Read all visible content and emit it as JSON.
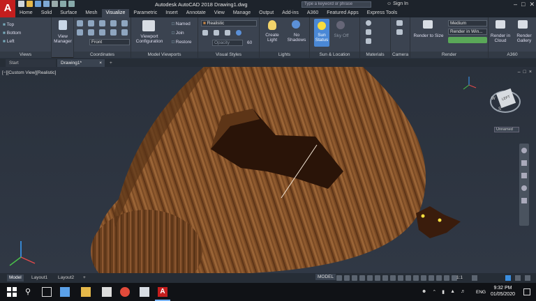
{
  "titlebar": {
    "app_logo": "A",
    "title": "Autodesk AutoCAD 2018    Drawing1.dwg",
    "search_placeholder": "Type a keyword or phrase",
    "signin": "Sign In"
  },
  "tabs": [
    "Home",
    "Solid",
    "Surface",
    "Mesh",
    "Visualize",
    "Parametric",
    "Insert",
    "Annotate",
    "View",
    "Manage",
    "Output",
    "Add-ins",
    "A360",
    "Featured Apps",
    "Express Tools"
  ],
  "active_tab": "Visualize",
  "ribbon": {
    "views": {
      "title": "Views",
      "items": [
        "Top",
        "Bottom",
        "Left"
      ]
    },
    "view_manager": "View Manager",
    "coordinates": {
      "title": "Coordinates",
      "ucs_value": "Front"
    },
    "model_viewports": {
      "title": "Model Viewports",
      "viewport_config": "Viewport Configuration",
      "named": "Named",
      "join": "Join",
      "restore": "Restore"
    },
    "visual_styles": {
      "title": "Visual Styles",
      "style_value": "Realistic",
      "opacity_value": "60"
    },
    "lights": {
      "title": "Lights",
      "create_light": "Create Light",
      "no_shadows": "No Shadows"
    },
    "sun_location": {
      "title": "Sun & Location",
      "sun_status": "Sun Status",
      "sky_off": "Sky Off"
    },
    "materials": {
      "title": "Materials"
    },
    "camera": {
      "title": "Camera"
    },
    "render": {
      "title": "Render",
      "render_to_size": "Render to Size",
      "quality": "Medium",
      "render_in": "Render in Win...",
      "render_cloud": "Render in Cloud",
      "render_gallery": "Render Gallery"
    },
    "a360": {
      "title": "A360"
    }
  },
  "file_tabs": [
    "Start",
    "Drawing1*"
  ],
  "viewport": {
    "label": "[−][Custom View][Realistic]",
    "viewcube_face": "LEFT",
    "viewcube_w": "W",
    "viewcube_s": "S",
    "unnamed": "Unnamed"
  },
  "layout_tabs": [
    "Model",
    "Layout1",
    "Layout2"
  ],
  "status": {
    "model": "MODEL",
    "scale": "1:1"
  },
  "taskbar": {
    "time": "9:32 PM",
    "date": "01/05/2020",
    "lang": "ENG"
  },
  "colors": {
    "accent": "#c41e1e",
    "ribbon_bg": "#3b4350",
    "wood": "#7a4a24"
  }
}
